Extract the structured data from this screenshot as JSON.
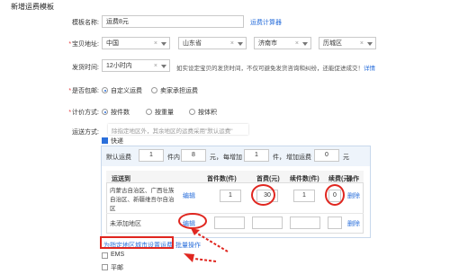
{
  "page": {
    "title": "新增运费模板"
  },
  "form": {
    "name_label": "模板名称:",
    "name_value": "运费8元",
    "calc_link": "运费计算器",
    "origin_label": "宝贝地址:",
    "origin": [
      "中国",
      "山东省",
      "济南市",
      "历城区"
    ],
    "ship_label": "发货时间:",
    "ship_value": "12小时内",
    "ship_hint_prefix": "如实设定宝贝的发货时间，不仅可避免发货咨询和纠纷，还能促进成交！",
    "ship_hint_link": "详情",
    "free_label": "是否包邮:",
    "free_options": [
      "自定义运费",
      "卖家承担运费"
    ],
    "pricing_label": "计价方式:",
    "pricing_options": [
      "按件数",
      "按重量",
      "按体积"
    ],
    "delivery_label": "运送方式:",
    "delivery_hint": "除指定地区外，其余地区的运费采用\"默认运费\"",
    "express_label": "快递"
  },
  "default_row": {
    "prefix": "默认运费",
    "first_qty": "1",
    "first_unit": "件内",
    "first_price": "8",
    "yuan1": "元，",
    "each_add": "每增加",
    "add_qty": "1",
    "unit_jian": "件，",
    "add_fee": "增加运费",
    "add_price": "0",
    "yuan2": "元"
  },
  "table": {
    "headers": [
      "运送到",
      "首件数(件)",
      "首费(元)",
      "续件数(件)",
      "续费(元)",
      "操作"
    ],
    "rows": [
      {
        "regions": "内蒙古自治区、广西壮族自治区、新疆维吾尔自治区",
        "edit": "编辑",
        "first_qty": "1",
        "first_fee": "30",
        "add_qty": "1",
        "add_fee": "0",
        "action": "删除"
      },
      {
        "regions": "未添加地区",
        "edit": "编辑",
        "first_qty": "",
        "first_fee": "",
        "add_qty": "",
        "add_fee": "",
        "action": "删除"
      }
    ]
  },
  "footer": {
    "set_link": "为指定地区城市设置运费",
    "batch_link": "批量操作",
    "ems_label": "EMS",
    "mail_label": "平邮"
  },
  "colors": {
    "accent": "#2a6fdb",
    "annotation": "#e0261f"
  }
}
